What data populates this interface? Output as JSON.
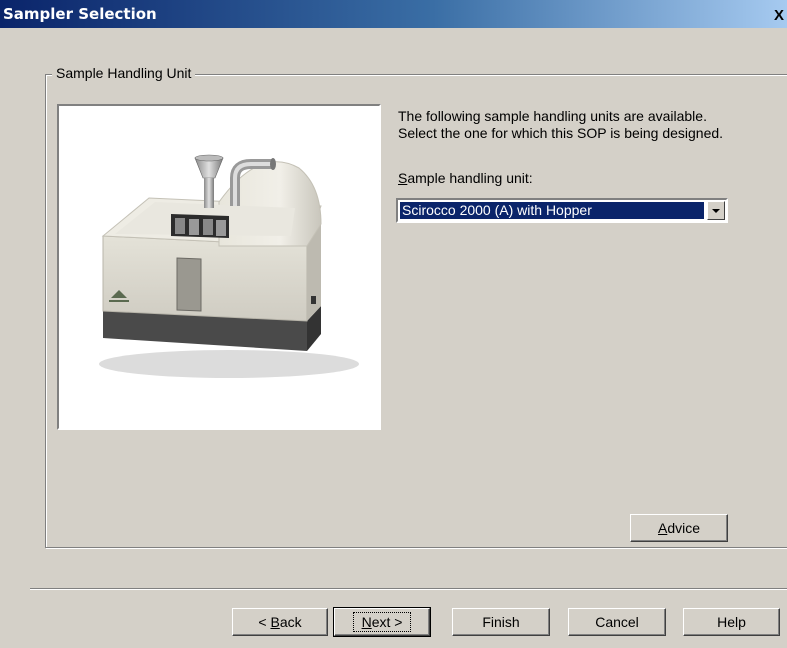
{
  "window": {
    "title": "Sampler Selection",
    "close_glyph": "X"
  },
  "group": {
    "label": "Sample Handling Unit"
  },
  "image": {
    "description_icon": "sampler-device-image"
  },
  "instructions": {
    "line1": "The following sample handling units are available.",
    "line2": "Select the one for which this SOP is being designed."
  },
  "combo": {
    "label_mnemonic": "S",
    "label_rest": "ample handling unit:",
    "value": "Scirocco 2000 (A) with Hopper"
  },
  "advice_button": {
    "mnemonic": "A",
    "rest": "dvice"
  },
  "footer": {
    "back": {
      "prefix": "< ",
      "mnemonic": "B",
      "rest": "ack"
    },
    "next": {
      "mnemonic": "N",
      "rest": "ext >"
    },
    "finish": "Finish",
    "cancel": "Cancel",
    "help": "Help"
  },
  "colors": {
    "title_gradient_start": "#0a246a",
    "title_gradient_end": "#a6caf0",
    "dialog_bg": "#d4d0c8",
    "selection": "#0a246a"
  }
}
